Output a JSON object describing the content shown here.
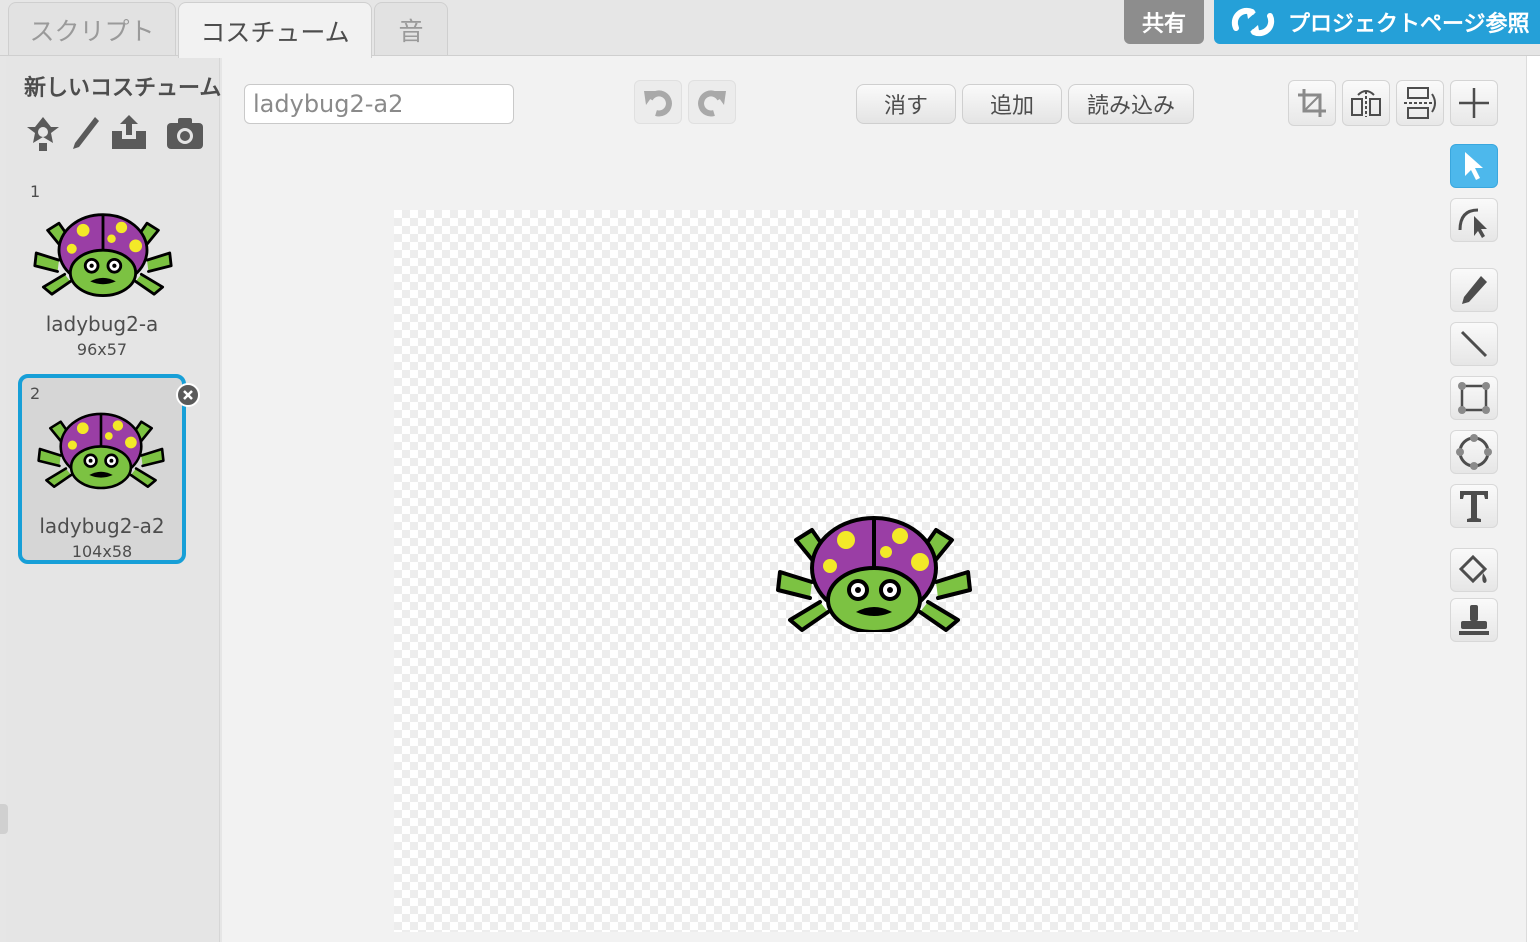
{
  "tabs": {
    "script": "スクリプト",
    "costumes": "コスチューム",
    "sounds": "音"
  },
  "header": {
    "share": "共有",
    "project_page": "プロジェクトページ参照"
  },
  "left": {
    "new_costume_label": "新しいコスチューム:",
    "costumes": [
      {
        "number": "1",
        "name": "ladybug2-a",
        "size": "96x57"
      },
      {
        "number": "2",
        "name": "ladybug2-a2",
        "size": "104x58"
      }
    ]
  },
  "editor": {
    "costume_name": "ladybug2-a2",
    "clear": "消す",
    "add": "追加",
    "import": "読み込み"
  },
  "colors": {
    "accent": "#25a0d8",
    "selection": "#179fd7",
    "bug_body": "#7cc242",
    "bug_shell": "#9a3ea5",
    "bug_spots": "#f3e928"
  }
}
